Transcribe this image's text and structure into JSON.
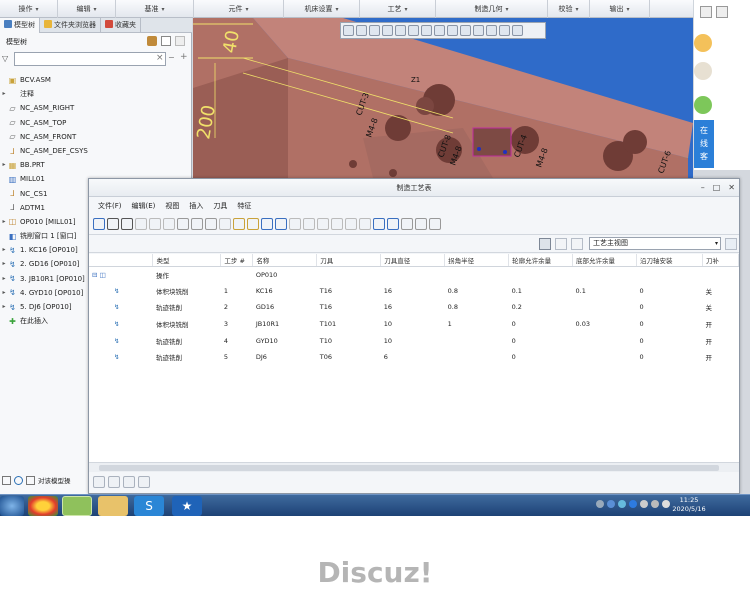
{
  "ribbon": {
    "menus": [
      "操作",
      "编辑",
      "基准",
      "元件",
      "机床设置",
      "工艺",
      "制造几何",
      "校验",
      "输出"
    ]
  },
  "left_panel": {
    "tabs": [
      "模型树",
      "文件夹浏览器",
      "收藏夹"
    ],
    "tree_title": "模型树",
    "search_placeholder": "",
    "items": [
      {
        "label": "BCV.ASM",
        "expand": "",
        "icon": "asm-icon"
      },
      {
        "label": "注释",
        "expand": "▸",
        "icon": ""
      },
      {
        "label": "NC_ASM_RIGHT",
        "expand": "",
        "icon": "datum-plane-icon"
      },
      {
        "label": "NC_ASM_TOP",
        "expand": "",
        "icon": "datum-plane-icon"
      },
      {
        "label": "NC_ASM_FRONT",
        "expand": "",
        "icon": "datum-plane-icon"
      },
      {
        "label": "NC_ASM_DEF_CSYS",
        "expand": "",
        "icon": "csys-icon"
      },
      {
        "label": "BB.PRT",
        "expand": "▸",
        "icon": "part-icon"
      },
      {
        "label": "MILL01",
        "expand": "",
        "icon": "workcell-icon"
      },
      {
        "label": "NC_CS1",
        "expand": "",
        "icon": "csys-icon"
      },
      {
        "label": "ADTM1",
        "expand": "",
        "icon": "axis-icon"
      },
      {
        "label": "OP010 [MILL01]",
        "expand": "▸",
        "icon": "operation-icon"
      },
      {
        "label": "铣削窗口 1 [窗口]",
        "expand": "",
        "icon": "window-icon"
      },
      {
        "label": "1. KC16 [OP010]",
        "expand": "▸",
        "icon": "sequence-icon"
      },
      {
        "label": "2. GD16 [OP010]",
        "expand": "▸",
        "icon": "sequence-icon"
      },
      {
        "label": "3. JB10R1 [OP010]",
        "expand": "▸",
        "icon": "sequence-icon"
      },
      {
        "label": "4. GYD10 [OP010]",
        "expand": "▸",
        "icon": "sequence-icon"
      },
      {
        "label": "5. DJ6 [OP010]",
        "expand": "▸",
        "icon": "sequence-icon"
      },
      {
        "label": "在此插入",
        "expand": "",
        "icon": "insert-icon"
      }
    ],
    "bottom_label": "对该模型操"
  },
  "viewport": {
    "dims": [
      "40",
      "200"
    ],
    "labels": [
      "CUT-3",
      "CUT-8",
      "CUT-4",
      "CUT-6",
      "M4-8",
      "M4-8",
      "M4-8",
      "Z1"
    ]
  },
  "right_strip": {
    "labels": [
      "在",
      "线",
      "客"
    ]
  },
  "dialog": {
    "title": "制造工艺表",
    "menu": [
      "文件(F)",
      "编辑(E)",
      "视图",
      "插入",
      "刀具",
      "特征"
    ],
    "view_select": "工艺主视图",
    "columns": [
      "类型",
      "工步 #",
      "名称",
      "刀具",
      "刀具直径",
      "拐角半径",
      "轮廓允许余量",
      "底部允许余量",
      "沿刀轴安装",
      "刀补"
    ],
    "rows": [
      {
        "type": "操作",
        "step": "",
        "name": "OP010",
        "tool": "",
        "diam": "",
        "corner": "",
        "prof": "",
        "bottom": "",
        "axis": "",
        "comp": "",
        "level": 0
      },
      {
        "type": "体积块铣削",
        "step": "1",
        "name": "KC16",
        "tool": "T16",
        "diam": "16",
        "corner": "0.8",
        "prof": "0.1",
        "bottom": "0.1",
        "axis": "0",
        "comp": "关",
        "level": 1
      },
      {
        "type": "轨迹铣削",
        "step": "2",
        "name": "GD16",
        "tool": "T16",
        "diam": "16",
        "corner": "0.8",
        "prof": "0.2",
        "bottom": "",
        "axis": "0",
        "comp": "关",
        "level": 1
      },
      {
        "type": "体积块铣削",
        "step": "3",
        "name": "JB10R1",
        "tool": "T101",
        "diam": "10",
        "corner": "1",
        "prof": "0",
        "bottom": "0.03",
        "axis": "0",
        "comp": "开",
        "level": 1
      },
      {
        "type": "轨迹铣削",
        "step": "4",
        "name": "GYD10",
        "tool": "T10",
        "diam": "10",
        "corner": "",
        "prof": "0",
        "bottom": "",
        "axis": "0",
        "comp": "开",
        "level": 1
      },
      {
        "type": "轨迹铣削",
        "step": "5",
        "name": "DJ6",
        "tool": "T06",
        "diam": "6",
        "corner": "",
        "prof": "0",
        "bottom": "",
        "axis": "0",
        "comp": "开",
        "level": 1
      }
    ]
  },
  "taskbar": {
    "time": "11:25",
    "date": "2020/5/16"
  },
  "watermark": "Discuz!"
}
